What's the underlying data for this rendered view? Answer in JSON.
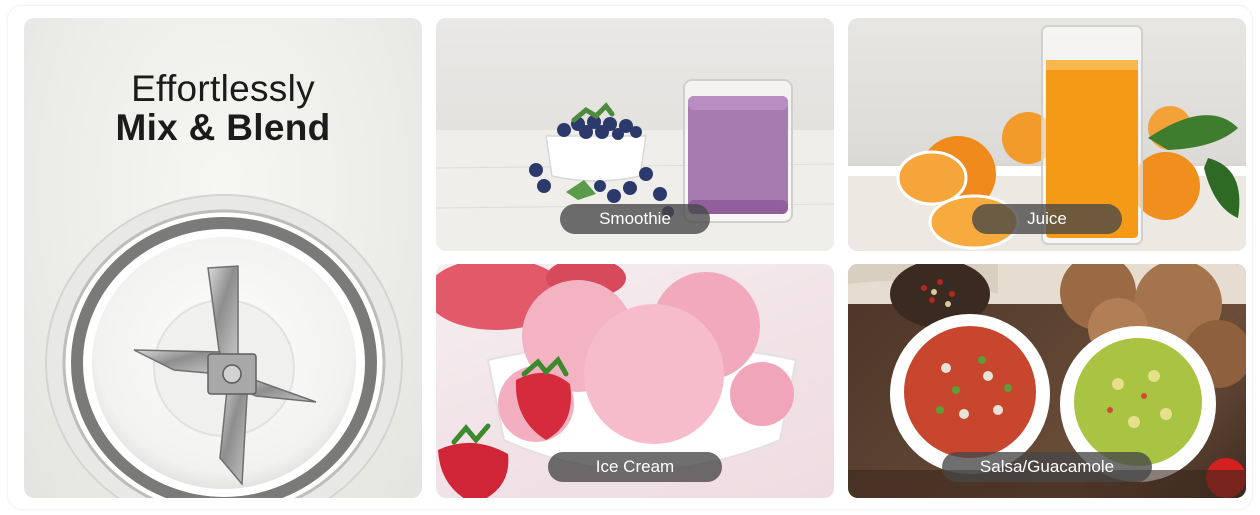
{
  "hero": {
    "line1": "Effortlessly",
    "line2": "Mix & Blend",
    "image": "blender-blade-icon"
  },
  "tiles": [
    {
      "label": "Smoothie",
      "image": "smoothie-photo"
    },
    {
      "label": "Juice",
      "image": "orange-juice-photo"
    },
    {
      "label": "Ice Cream",
      "image": "ice-cream-photo"
    },
    {
      "label": "Salsa/Guacamole",
      "image": "salsa-guacamole-photo"
    }
  ],
  "colors": {
    "label_background": "#464646",
    "label_text": "#ffffff",
    "title_text": "#1b1b1b"
  }
}
